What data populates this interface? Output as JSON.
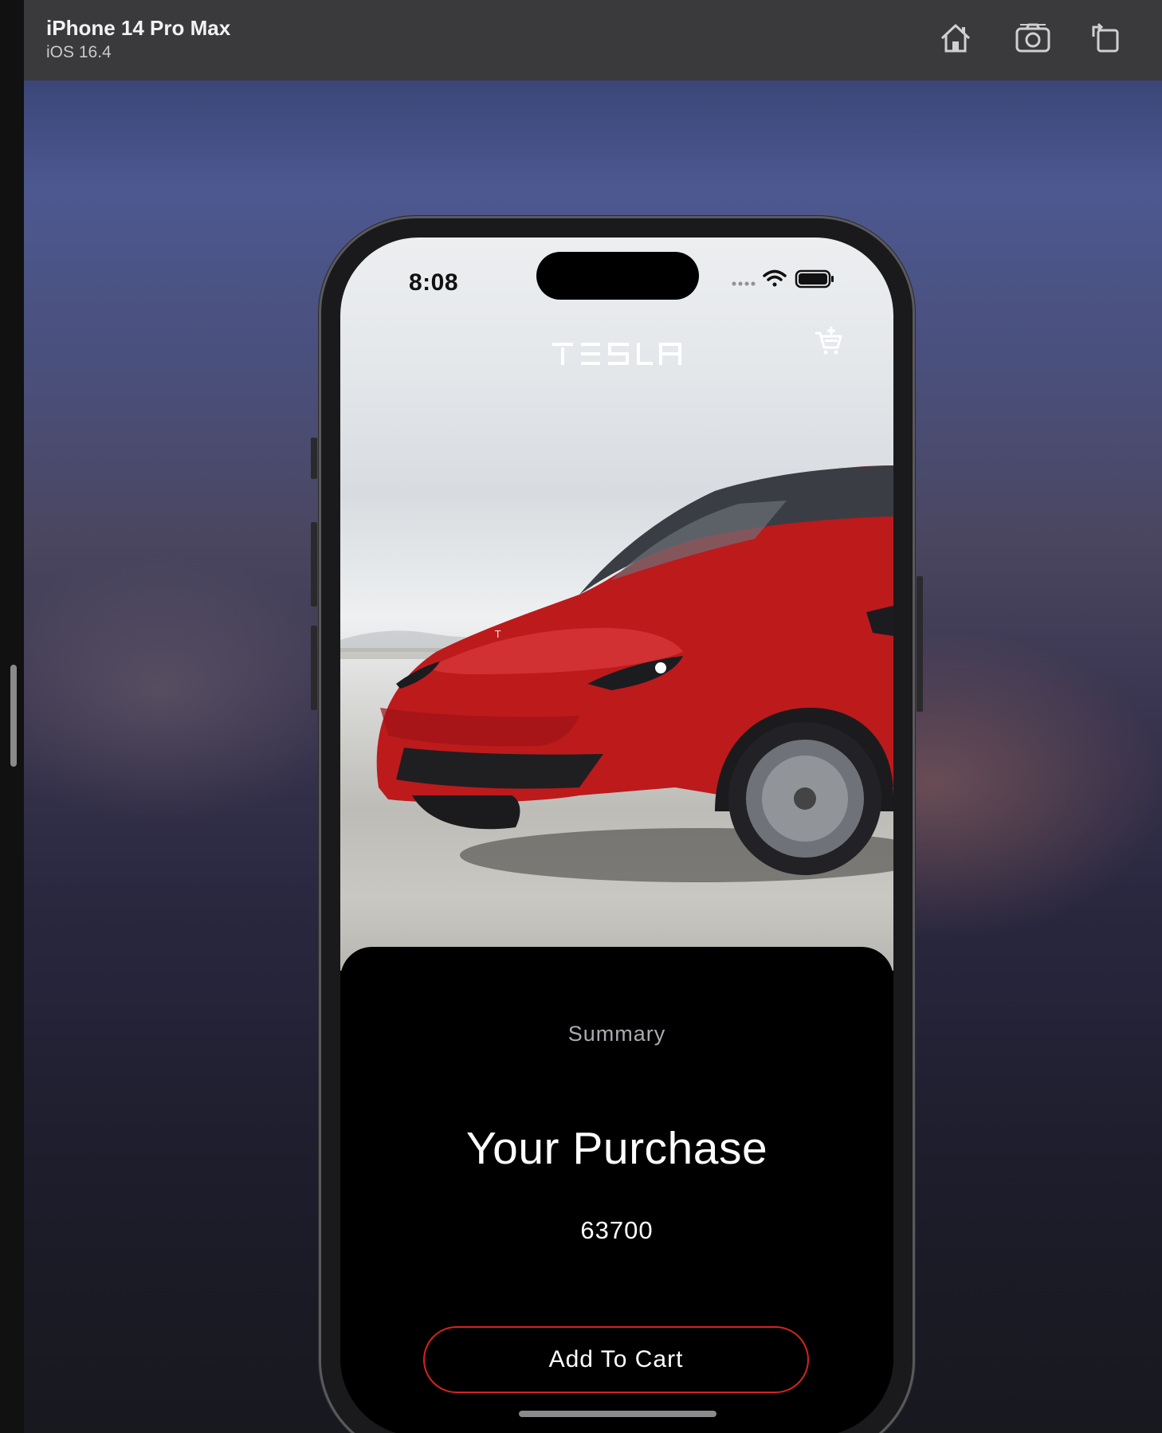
{
  "window": {
    "title": "iPhone 14 Pro Max",
    "subtitle": "iOS 16.4",
    "toolbar_icons": [
      "home-icon",
      "screenshot-icon",
      "rotate-icon"
    ]
  },
  "status_bar": {
    "time": "8:08",
    "icons": [
      "signal-dots-icon",
      "wifi-icon",
      "battery-icon"
    ]
  },
  "header": {
    "brand": "TESLA",
    "cart_icon": "add-to-cart-icon"
  },
  "hero": {
    "image": "red-tesla-model-y-photo"
  },
  "summary": {
    "eyebrow": "Summary",
    "title": "Your Purchase",
    "price": "63700",
    "button_label": "Add To Cart"
  },
  "colors": {
    "accent_border": "#d6231f",
    "sheet_background": "#000000",
    "car_red": "#c0161a"
  }
}
